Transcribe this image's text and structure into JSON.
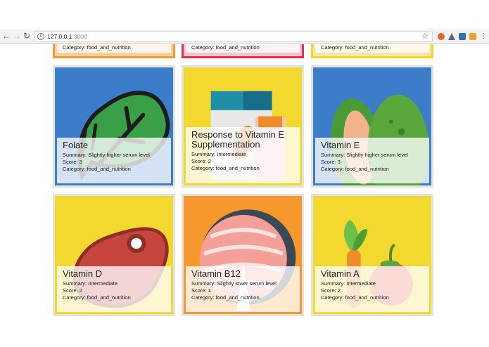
{
  "browser": {
    "url_host": "127.0.0.1",
    "url_port": ":3000"
  },
  "partial_cards": [
    {
      "category_line": "Category: food_and_nutrition",
      "bg": "#f8cfa0",
      "border": "#f59a3b"
    },
    {
      "category_line": "Category: food_and_nutrition",
      "bg": "#f4c4cf",
      "border": "#e2304f"
    },
    {
      "category_line": "Category: food_and_nutrition",
      "bg": "#f4e6a8",
      "border": "#f2d42a"
    }
  ],
  "cards": [
    {
      "title": "Folate",
      "summary": "Summary: Slightly higher serum level",
      "score": "Score: 3",
      "category": "Category: food_and_nutrition",
      "bg": "#3b7dc9",
      "icon": "spinach-leaf-icon"
    },
    {
      "title": "Response to Vitamin E Supplementation",
      "summary": "Summary: Intermediate",
      "score": "Score: 2",
      "category": "Category: food_and_nutrition",
      "bg": "#f3d92f",
      "icon": "supplement-bottles-icon"
    },
    {
      "title": "Vitamin E",
      "summary": "Summary: Slightly higher serum level",
      "score": "Score: 3",
      "category": "Category: food_and_nutrition",
      "bg": "#3b7dc9",
      "icon": "avocado-icon"
    },
    {
      "title": "Vitamin D",
      "summary": "Summary: Intermediate",
      "score": "Score: 2",
      "category": "Category: food_and_nutrition",
      "bg": "#f3d92f",
      "icon": "steak-icon"
    },
    {
      "title": "Vitamin B12",
      "summary": "Summary: Slightly lower serum level",
      "score": "Score: 1",
      "category": "Category: food_and_nutrition",
      "bg": "#f7982f",
      "icon": "salmon-steak-icon"
    },
    {
      "title": "Vitamin A",
      "summary": "Summary: Intermediate",
      "score": "Score: 2",
      "category": "Category: food_and_nutrition",
      "bg": "#f3d92f",
      "icon": "carrot-tomato-icon"
    }
  ]
}
